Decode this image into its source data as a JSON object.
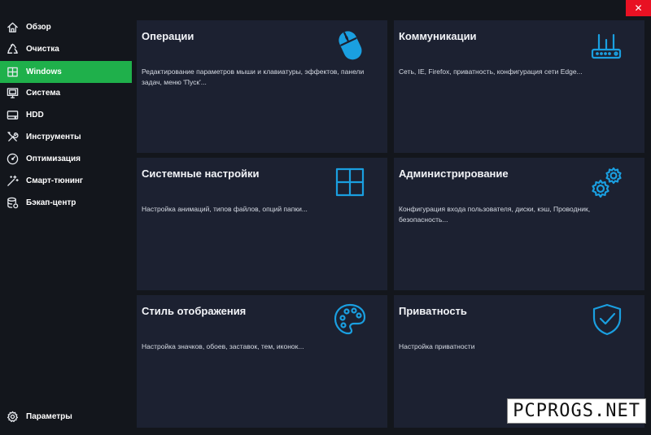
{
  "window": {
    "close_label": "✕"
  },
  "sidebar": {
    "items": [
      {
        "label": "Обзор",
        "icon": "home-icon",
        "active": false
      },
      {
        "label": "Очистка",
        "icon": "recycle-icon",
        "active": false
      },
      {
        "label": "Windows",
        "icon": "windows-icon",
        "active": true
      },
      {
        "label": "Система",
        "icon": "monitor-icon",
        "active": false
      },
      {
        "label": "HDD",
        "icon": "hdd-icon",
        "active": false
      },
      {
        "label": "Инструменты",
        "icon": "tools-icon",
        "active": false
      },
      {
        "label": "Оптимизация",
        "icon": "gauge-icon",
        "active": false
      },
      {
        "label": "Смарт-тюнинг",
        "icon": "magic-wand-icon",
        "active": false
      },
      {
        "label": "Бэкап-центр",
        "icon": "database-icon",
        "active": false
      }
    ],
    "settings": {
      "label": "Параметры",
      "icon": "gear-icon"
    },
    "accent_color": "#1fb04b"
  },
  "cards": [
    {
      "title": "Операции",
      "desc": "Редактирование параметров мыши и клавиатуры, эффектов, панели задач, меню 'Пуск'...",
      "icon": "mouse-icon"
    },
    {
      "title": "Коммуникации",
      "desc": "Сеть, IE, Firefox, приватность, конфигурация сети Edge...",
      "icon": "router-icon"
    },
    {
      "title": "Системные настройки",
      "desc": "Настройка анимаций, типов файлов, опций папки...",
      "icon": "windows-logo-icon"
    },
    {
      "title": "Администрирование",
      "desc": "Конфигурация входа пользователя, диски, кэш, Проводник, безопасность...",
      "icon": "gears-icon"
    },
    {
      "title": "Стиль отображения",
      "desc": "Настройка значков, обоев, заставок, тем, иконок...",
      "icon": "palette-icon"
    },
    {
      "title": "Приватность",
      "desc": "Настройка приватности",
      "icon": "shield-icon"
    }
  ],
  "icon_color": "#1a9fe0",
  "watermark": "PCPROGS.NET"
}
